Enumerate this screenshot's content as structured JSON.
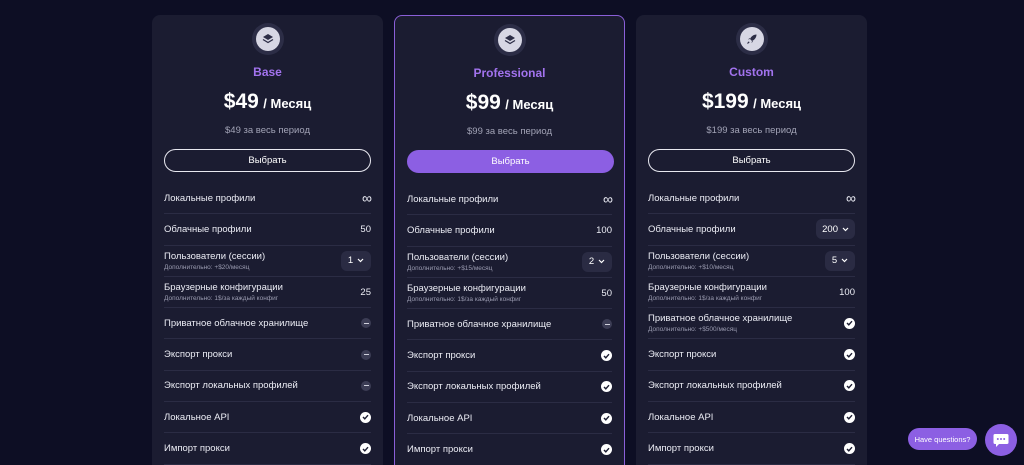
{
  "colors": {
    "accent": "#8c5fe3",
    "plan_name": "#a273ee",
    "card_bg": "#1b1c31",
    "page_bg": "#0d0e24"
  },
  "plans": [
    {
      "icon": "layers-icon",
      "name": "Base",
      "price": "$49",
      "per": "/ Месяц",
      "period": "$49 за весь период",
      "button": "Выбрать",
      "features": [
        {
          "label": "Локальные профили",
          "value": "∞"
        },
        {
          "label": "Облачные профили",
          "value": "50"
        },
        {
          "label": "Пользователи (сессии)",
          "sub": "Дополнительно: +$20/месяц",
          "value": "1"
        },
        {
          "label": "Браузерные конфигурации",
          "sub": "Дополнительно: 1$/за каждый конфиг",
          "value": "25"
        },
        {
          "label": "Приватное облачное хранилище"
        },
        {
          "label": "Экспорт прокси"
        },
        {
          "label": "Экспорт локальных профилей"
        },
        {
          "label": "Локальное API"
        },
        {
          "label": "Импорт прокси"
        }
      ]
    },
    {
      "icon": "layers-icon",
      "name": "Professional",
      "price": "$99",
      "per": "/ Месяц",
      "period": "$99 за весь период",
      "button": "Выбрать",
      "features": [
        {
          "label": "Локальные профили",
          "value": "∞"
        },
        {
          "label": "Облачные профили",
          "value": "100"
        },
        {
          "label": "Пользователи (сессии)",
          "sub": "Дополнительно: +$15/месяц",
          "value": "2"
        },
        {
          "label": "Браузерные конфигурации",
          "sub": "Дополнительно: 1$/за каждый конфиг",
          "value": "50"
        },
        {
          "label": "Приватное облачное хранилище"
        },
        {
          "label": "Экспорт прокси"
        },
        {
          "label": "Экспорт локальных профилей"
        },
        {
          "label": "Локальное API"
        },
        {
          "label": "Импорт прокси"
        }
      ]
    },
    {
      "icon": "rocket-icon",
      "name": "Custom",
      "price": "$199",
      "per": "/ Месяц",
      "period": "$199 за весь период",
      "button": "Выбрать",
      "features": [
        {
          "label": "Локальные профили",
          "value": "∞"
        },
        {
          "label": "Облачные профили",
          "value": "200"
        },
        {
          "label": "Пользователи (сессии)",
          "sub": "Дополнительно: +$10/месяц",
          "value": "5"
        },
        {
          "label": "Браузерные конфигурации",
          "sub": "Дополнительно: 1$/за каждый конфиг",
          "value": "100"
        },
        {
          "label": "Приватное облачное хранилище",
          "sub": "Дополнительно: +$500/месяц"
        },
        {
          "label": "Экспорт прокси"
        },
        {
          "label": "Экспорт локальных профилей"
        },
        {
          "label": "Локальное API"
        },
        {
          "label": "Импорт прокси"
        }
      ]
    }
  ],
  "support": {
    "help_label": "Have questions?",
    "chat_icon": "chat-bubble-icon"
  }
}
